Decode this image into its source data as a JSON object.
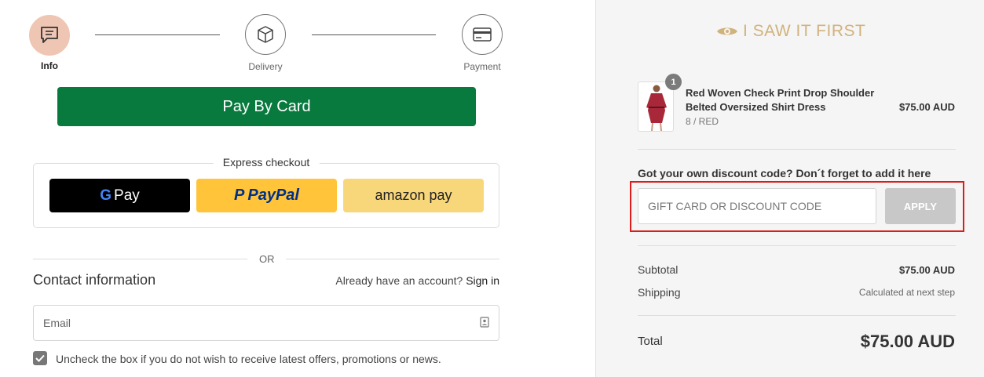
{
  "steps": [
    {
      "label": "Info",
      "icon": "chat-icon",
      "active": true
    },
    {
      "label": "Delivery",
      "icon": "box-icon",
      "active": false
    },
    {
      "label": "Payment",
      "icon": "credit-card-icon",
      "active": false
    }
  ],
  "pay_by_card_label": "Pay By Card",
  "express": {
    "title": "Express checkout",
    "gpay_label": "Pay",
    "paypal_label": "PayPal",
    "amazon_label": "amazon pay"
  },
  "or_label": "OR",
  "contact": {
    "title": "Contact information",
    "account_prompt": "Already have an account?",
    "sign_in": "Sign in",
    "email_placeholder": "Email",
    "newsletter_label": "Uncheck the box if you do not wish to receive latest offers, promotions or news.",
    "newsletter_checked": true
  },
  "brand": {
    "name": "I SAW IT FIRST",
    "color": "#d1b27c"
  },
  "cart": {
    "item": {
      "quantity": "1",
      "name": "Red Woven Check Print Drop Shoulder Belted Oversized Shirt Dress",
      "variant": "8 / RED",
      "price": "$75.00 AUD"
    }
  },
  "discount": {
    "title": "Got your own discount code? Don´t forget to add it here",
    "placeholder": "GIFT CARD OR DISCOUNT CODE",
    "apply_label": "APPLY"
  },
  "summary": {
    "subtotal_label": "Subtotal",
    "subtotal_value": "$75.00 AUD",
    "shipping_label": "Shipping",
    "shipping_value": "Calculated at next step",
    "total_label": "Total",
    "total_value": "$75.00 AUD"
  },
  "colors": {
    "pay_button": "#087a3e",
    "active_step": "#efc6b4",
    "paypal": "#ffc43a",
    "amazon": "#f8d77b",
    "highlight": "#dd1c1c"
  }
}
